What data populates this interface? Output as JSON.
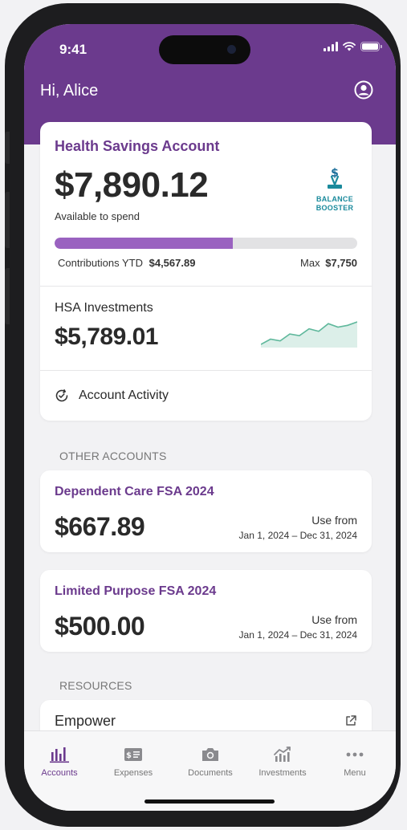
{
  "status": {
    "time": "9:41"
  },
  "header": {
    "greeting": "Hi, Alice"
  },
  "hsa": {
    "title": "Health Savings Account",
    "balance": "$7,890.12",
    "balance_label": "Available to spend",
    "booster_line1": "BALANCE",
    "booster_line2": "BOOSTER",
    "contrib_label": "Contributions YTD",
    "contrib_value": "$4,567.89",
    "max_label": "Max",
    "max_value": "$7,750",
    "contrib_fraction": 0.589
  },
  "investments": {
    "label": "HSA Investments",
    "value": "$5,789.01",
    "sparkline": [
      3.0,
      3.6,
      3.4,
      4.2,
      4.0,
      4.8,
      4.5,
      5.4,
      5.0,
      5.2,
      5.6
    ]
  },
  "activity": {
    "label": "Account Activity"
  },
  "other_accounts": {
    "heading": "OTHER ACCOUNTS",
    "items": [
      {
        "name": "Dependent Care FSA 2024",
        "amount": "$667.89",
        "use_from": "Use from",
        "range": "Jan 1, 2024 – Dec 31, 2024"
      },
      {
        "name": "Limited Purpose FSA 2024",
        "amount": "$500.00",
        "use_from": "Use from",
        "range": "Jan 1, 2024 – Dec 31, 2024"
      }
    ]
  },
  "resources": {
    "heading": "RESOURCES",
    "items": [
      {
        "label": "Empower"
      }
    ]
  },
  "tabs": [
    {
      "label": "Accounts",
      "icon": "bar-chart-icon",
      "active": true
    },
    {
      "label": "Expenses",
      "icon": "receipt-icon",
      "active": false
    },
    {
      "label": "Documents",
      "icon": "camera-icon",
      "active": false
    },
    {
      "label": "Investments",
      "icon": "trend-chart-icon",
      "active": false
    },
    {
      "label": "Menu",
      "icon": "more-dots-icon",
      "active": false
    }
  ],
  "colors": {
    "brand": "#6b3a8d",
    "progress": "#9a62c0",
    "teal": "#1a8a9c",
    "spark_fill": "#dcefe9",
    "spark_line": "#5fb89c"
  }
}
